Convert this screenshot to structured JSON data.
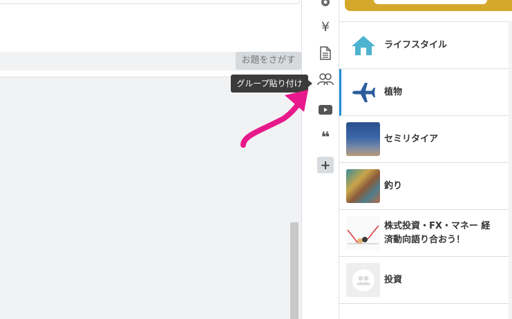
{
  "editor": {
    "topic_button": "お題をさがす"
  },
  "toolbar": {
    "tools": [
      {
        "icon": "gear-icon"
      },
      {
        "icon": "yen-icon",
        "glyph": "¥"
      },
      {
        "icon": "document-icon"
      },
      {
        "icon": "group-icon"
      },
      {
        "icon": "youtube-icon"
      },
      {
        "icon": "quote-icon",
        "glyph": "❝"
      },
      {
        "icon": "plus-icon",
        "glyph": "+"
      }
    ],
    "tooltip": "グループ貼り付け"
  },
  "groups": {
    "items": [
      {
        "label": "ライフスタイル",
        "icon": "house-icon"
      },
      {
        "label": "植物",
        "icon": "airplane-icon"
      },
      {
        "label": "セミリタイア",
        "icon": "sky-thumbnail"
      },
      {
        "label": "釣り",
        "icon": "reef-thumbnail"
      },
      {
        "label_line1": "株式投資・FX・マネー 経",
        "label_line2": "済動向語り合おう！",
        "icon": "stock-chart-thumbnail"
      },
      {
        "label": "投資",
        "icon": "default-group-icon"
      }
    ]
  },
  "colors": {
    "accent": "#1e90d6",
    "house": "#4db3cf",
    "plane": "#2c5c9c",
    "arrow": "#e8198b",
    "banner": "#d4a82a"
  }
}
